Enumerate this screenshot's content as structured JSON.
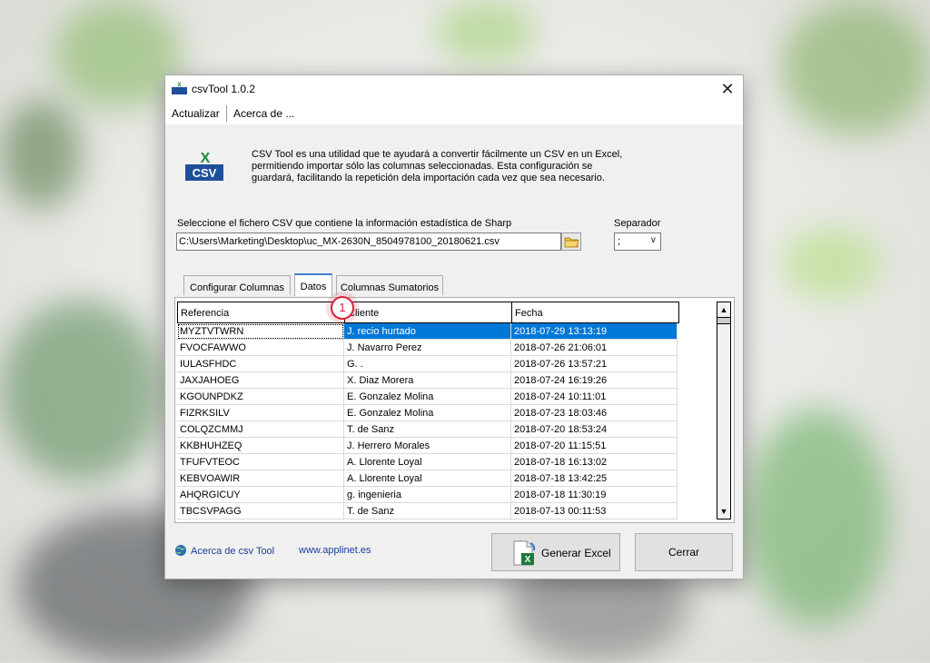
{
  "window": {
    "title": "csvTool 1.0.2",
    "close_glyph": "✕"
  },
  "menu": {
    "items": [
      "Actualizar",
      "Acerca de ..."
    ]
  },
  "logo": {
    "label": "CSV",
    "mark": "X"
  },
  "description": "CSV Tool es una utilidad que te ayudará a convertir fácilmente un CSV en un Excel, permitiendo importar sólo las columnas seleccionadas. Esta configuración se guardará, facilitando la repetición dela importación cada vez que sea necesario.",
  "file": {
    "label": "Seleccione el fichero CSV que contiene la información estadística de Sharp",
    "value": "C:\\Users\\Marketing\\Desktop\\uc_MX-2630N_8504978100_20180621.csv",
    "browse_icon": "folder-icon"
  },
  "separator": {
    "label": "Separador",
    "value": ";"
  },
  "tabs": [
    {
      "label": "Configurar Columnas",
      "active": false
    },
    {
      "label": "Datos",
      "active": true
    },
    {
      "label": "Columnas Sumatorios",
      "active": false
    }
  ],
  "grid": {
    "columns": [
      "Referencia",
      "Cliente",
      "Fecha"
    ],
    "rows": [
      [
        "MYZTVTWRN",
        "J. recio hurtado",
        "2018-07-29 13:13:19"
      ],
      [
        "FVOCFAWWO",
        "J. Navarro Perez",
        "2018-07-26 21:06:01"
      ],
      [
        "IULASFHDC",
        "G. .",
        "2018-07-26 13:57:21"
      ],
      [
        "JAXJAHOEG",
        "X. Diaz Morera",
        "2018-07-24 16:19:26"
      ],
      [
        "KGOUNPDKZ",
        "E. Gonzalez Molina",
        "2018-07-24 10:11:01"
      ],
      [
        "FIZRKSILV",
        "E. Gonzalez Molina",
        "2018-07-23 18:03:46"
      ],
      [
        "COLQZCMMJ",
        "T. de Sanz",
        "2018-07-20 18:53:24"
      ],
      [
        "KKBHUHZEQ",
        "J. Herrero Morales",
        "2018-07-20 11:15:51"
      ],
      [
        "TFUFVTEOC",
        "A. Llorente Loyal",
        "2018-07-18 16:13:02"
      ],
      [
        "KEBVOAWIR",
        "A. Llorente Loyal",
        "2018-07-18 13:42:25"
      ],
      [
        "AHQRGICUY",
        "g. ingenieria",
        "2018-07-18 11:30:19"
      ],
      [
        "TBCSVPAGG",
        "T. de Sanz",
        "2018-07-13 00:11:53"
      ]
    ],
    "selected_row": 0
  },
  "badge": {
    "number": "1",
    "color": "#d8213b"
  },
  "footer": {
    "about_link": "Acerca de csv Tool",
    "web_link": "www.applinet.es",
    "generate_button": "Generar Excel",
    "close_button": "Cerrar"
  }
}
